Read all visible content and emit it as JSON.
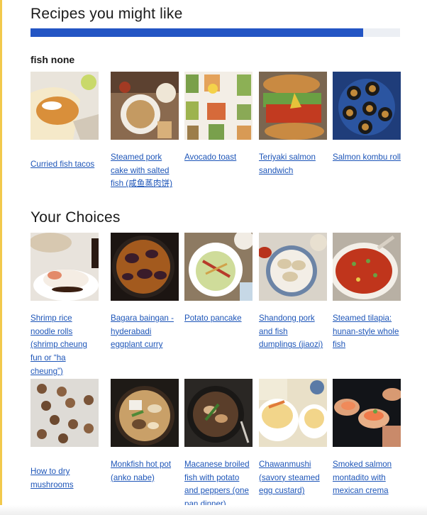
{
  "suggestions": {
    "title": "Recipes you might like",
    "progress": 0.9,
    "filter_label": "fish none",
    "recipes": [
      {
        "label": "Curried fish tacos"
      },
      {
        "label": "Steamed pork cake with salted fish (咸鱼蒸肉饼)"
      },
      {
        "label": "Avocado toast"
      },
      {
        "label": "Teriyaki salmon sandwich"
      },
      {
        "label": "Salmon kombu roll"
      }
    ]
  },
  "choices": {
    "title": "Your Choices",
    "recipes": [
      {
        "label": "Shrimp rice noodle rolls (shrimp cheung fun or “ha cheung”)"
      },
      {
        "label": "Bagara baingan - hyderabadi eggplant curry"
      },
      {
        "label": "Potato pancake"
      },
      {
        "label": "Shandong pork and fish dumplings (jiaozi)"
      },
      {
        "label": "Steamed tilapia: hunan-style whole fish"
      },
      {
        "label": "How to dry mushrooms"
      },
      {
        "label": "Monkfish hot pot (anko nabe)"
      },
      {
        "label": "Macanese broiled fish with potato and peppers (one pan dinner)"
      },
      {
        "label": "Chawanmushi (savory steamed egg custard)"
      },
      {
        "label": "Smoked salmon montadito with mexican crema"
      }
    ]
  },
  "colors": {
    "accent": "#f2c94c",
    "progress_fill": "#2355c4",
    "progress_track": "#eceff4",
    "link": "#1d55b8"
  }
}
